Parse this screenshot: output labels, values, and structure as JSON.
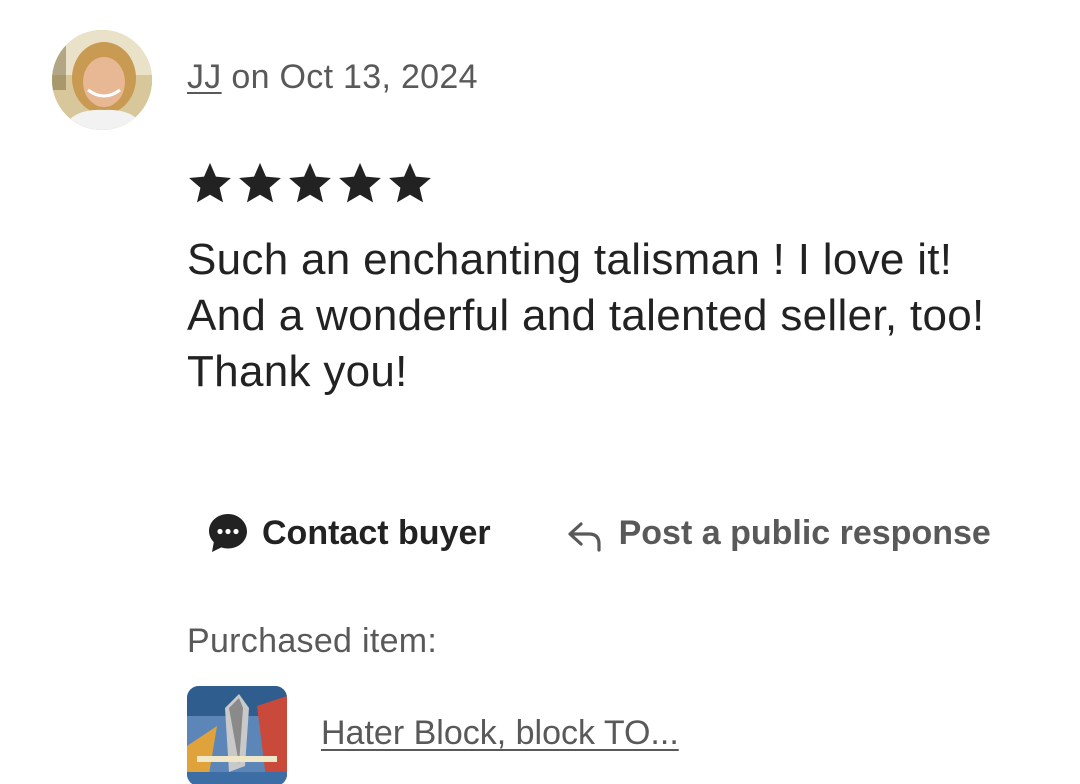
{
  "review": {
    "reviewer_name": "JJ",
    "date_text": " on Oct 13, 2024",
    "rating": 5,
    "rating_max": 5,
    "text": "Such an enchanting talisman ! I love it! And a wonderful and talented seller, too! Thank you!"
  },
  "actions": {
    "contact_label": "Contact buyer",
    "contact_icon": "chat-bubble-icon",
    "respond_label": "Post a public response",
    "respond_icon": "reply-arrow-icon"
  },
  "purchase": {
    "label": "Purchased item:",
    "item_title": "Hater Block, block TO..."
  },
  "colors": {
    "text_primary": "#222222",
    "text_secondary": "#595959",
    "star": "#222222"
  }
}
